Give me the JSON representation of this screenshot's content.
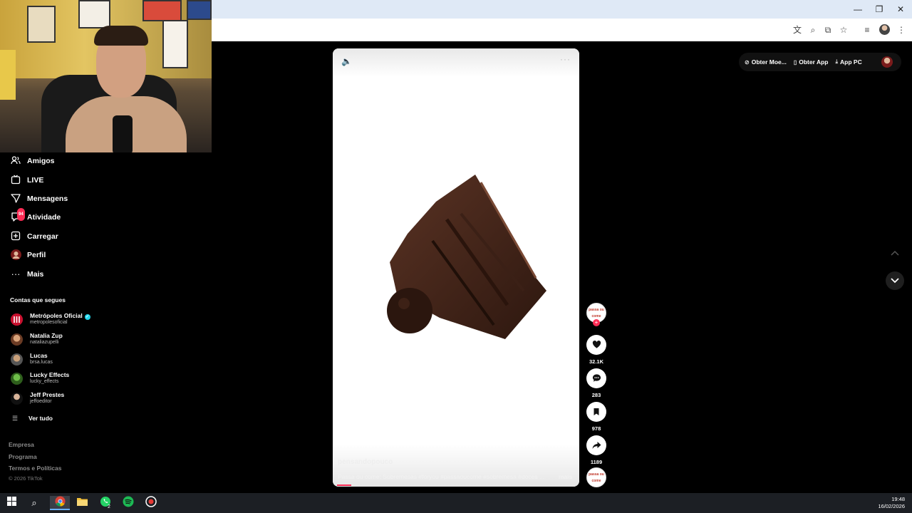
{
  "sidebar": {
    "items": [
      {
        "label": "Amigos",
        "icon": "friends-icon"
      },
      {
        "label": "LIVE",
        "icon": "live-icon"
      },
      {
        "label": "Mensagens",
        "icon": "messages-icon"
      },
      {
        "label": "Atividade",
        "icon": "activity-icon",
        "badge": "94"
      },
      {
        "label": "Carregar",
        "icon": "upload-icon"
      },
      {
        "label": "Perfil",
        "icon": "profile-icon"
      },
      {
        "label": "Mais",
        "icon": "more-icon"
      }
    ],
    "following_title": "Contas que segues",
    "accounts": [
      {
        "name": "Metrópoles Oficial",
        "handle": "metropolesoficial",
        "verified": true
      },
      {
        "name": "Natalia Zup",
        "handle": "nataliazupelli"
      },
      {
        "name": "Lucas",
        "handle": "brsa.lucas"
      },
      {
        "name": "Lucky Effects",
        "handle": "lucky_effects"
      },
      {
        "name": "Jeff Prestes",
        "handle": "jeffoeditor"
      }
    ],
    "see_all": "Ver tudo",
    "footer": [
      "Empresa",
      "Programa",
      "Termos e Políticas"
    ],
    "copyright": "© 2026 TikTok"
  },
  "header": {
    "coins": "Obter Moe...",
    "get_app": "Obter App",
    "pc_app": "App PC"
  },
  "video": {
    "author": "pensandopouco",
    "caption": "Passa ou come: Sobremesas #foryou #passaoucome #sobremesa #doces ...",
    "more": "mais",
    "progress": 0.06
  },
  "actions": {
    "creator_avatar_text": "passa ou come",
    "likes": "32.1K",
    "comments": "283",
    "saves": "978",
    "shares": "1189"
  },
  "taskbar": {
    "time": "19:48",
    "date": "16/02/2026",
    "whatsapp_badge": "2"
  },
  "colors": {
    "accent": "#fe2c55",
    "verified": "#20d5ec"
  }
}
